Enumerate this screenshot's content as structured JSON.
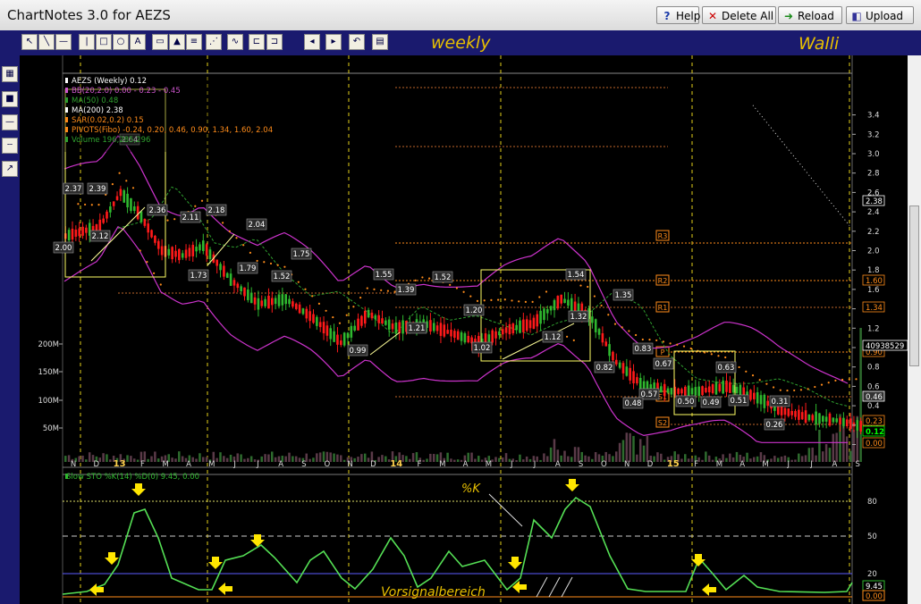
{
  "window": {
    "title": "ChartNotes 3.0 for AEZS"
  },
  "header_buttons": [
    {
      "label": "Help",
      "icon": "?",
      "color": "#1a3aa8"
    },
    {
      "label": "Delete All",
      "icon": "✕",
      "color": "#cc0000"
    },
    {
      "label": "Reload",
      "icon": "➜",
      "color": "#1a8a1a"
    },
    {
      "label": "Upload",
      "icon": "◧",
      "color": "#333399"
    }
  ],
  "toolbar": {
    "period_label": "weekly",
    "signature": "Walli"
  },
  "tools": [
    "pointer",
    "line",
    "horizontal-line",
    "vertical-line",
    "rectangle",
    "ellipse",
    "text",
    "note",
    "arrow-up",
    "fibonacci",
    "gann-fan",
    "wave",
    "range",
    "channel",
    "arrow-left",
    "arrow-right",
    "undo",
    "settings"
  ],
  "side_tools": [
    "color-palette",
    "line-color",
    "line-width",
    "line-style",
    "cursor"
  ],
  "chart": {
    "legend": [
      {
        "text": "AEZS (Weekly) 0.12",
        "color": "#ffffff"
      },
      {
        "text": "BB(20,2.0) 0.00 - 0.23 - 0.45",
        "color": "#cc55cc"
      },
      {
        "text": "MA(50) 0.48",
        "color": "#2fa02f"
      },
      {
        "text": "MA(200) 2.38",
        "color": "#ffffff"
      },
      {
        "text": "SAR(0.02,0.2) 0.15",
        "color": "#ff8c1a"
      },
      {
        "text": "PIVOTS(Fibo) -0.24, 0.20, 0.46, 0.90, 1.34, 1.60, 2.04",
        "color": "#ff8c1a"
      },
      {
        "text": "Volume 196,285,296",
        "color": "#2fa02f"
      }
    ],
    "price_axis": [
      "3.4",
      "3.2",
      "3.0",
      "2.8",
      "2.6",
      "2.4",
      "2.2",
      "2.0",
      "1.8",
      "1.6",
      "1.4",
      "1.2",
      "1.0",
      "0.8",
      "0.6",
      "0.4",
      "0.2",
      "0.0"
    ],
    "volume_axis": [
      "200M",
      "150M",
      "100M",
      "50M"
    ],
    "axis_tags": [
      {
        "text": "2.38",
        "color": "#ffffff",
        "bg": "#000"
      },
      {
        "text": "1.60",
        "color": "#ff8c1a",
        "bg": "#000"
      },
      {
        "text": "1.34",
        "color": "#ff8c1a",
        "bg": "#000"
      },
      {
        "text": "0.90",
        "color": "#ff8c1a",
        "bg": "#000"
      },
      {
        "text": "0.46",
        "color": "#ffffff",
        "bg": "#333"
      },
      {
        "text": "0.23",
        "color": "#ff8c1a",
        "bg": "#000"
      },
      {
        "text": "0.12",
        "color": "#00ff00",
        "bg": "#000"
      },
      {
        "text": "0.00",
        "color": "#ff8c1a",
        "bg": "#000"
      },
      {
        "text": "40938529",
        "color": "#ffffff",
        "bg": "#000"
      }
    ],
    "pivot_labels": [
      "R3",
      "R2",
      "R1",
      "P",
      "S1",
      "S2"
    ],
    "price_labels": [
      "2.00",
      "2.37",
      "2.39",
      "2.12",
      "2.64",
      "2.36",
      "2.11",
      "2.18",
      "1.73",
      "2.04",
      "1.79",
      "1.75",
      "1.52",
      "1.55",
      "1.39",
      "1.21",
      "0.99",
      "1.52",
      "1.20",
      "1.02",
      "1.54",
      "1.32",
      "1.12",
      "1.35",
      "0.82",
      "0.83",
      "0.57",
      "0.48",
      "0.67",
      "0.50",
      "0.49",
      "0.63",
      "0.51",
      "0.31",
      "0.26"
    ],
    "time_axis": [
      "N",
      "D",
      "13",
      "F",
      "M",
      "A",
      "M",
      "J",
      "J",
      "A",
      "S",
      "O",
      "N",
      "D",
      "14",
      "F",
      "M",
      "A",
      "M",
      "J",
      "J",
      "A",
      "S",
      "O",
      "N",
      "D",
      "15",
      "F",
      "M",
      "A",
      "M",
      "J",
      "J",
      "A",
      "S"
    ],
    "stochastic_legend": "Slow STO %K(14) %D(0) 9.45, 0.00",
    "stochastic_axis": [
      "80",
      "50",
      "20"
    ],
    "stochastic_tags": [
      "9.45",
      "0.00"
    ],
    "annotations": {
      "k_label": "%K",
      "presignal_label": "Vorsignalbereich"
    }
  }
}
